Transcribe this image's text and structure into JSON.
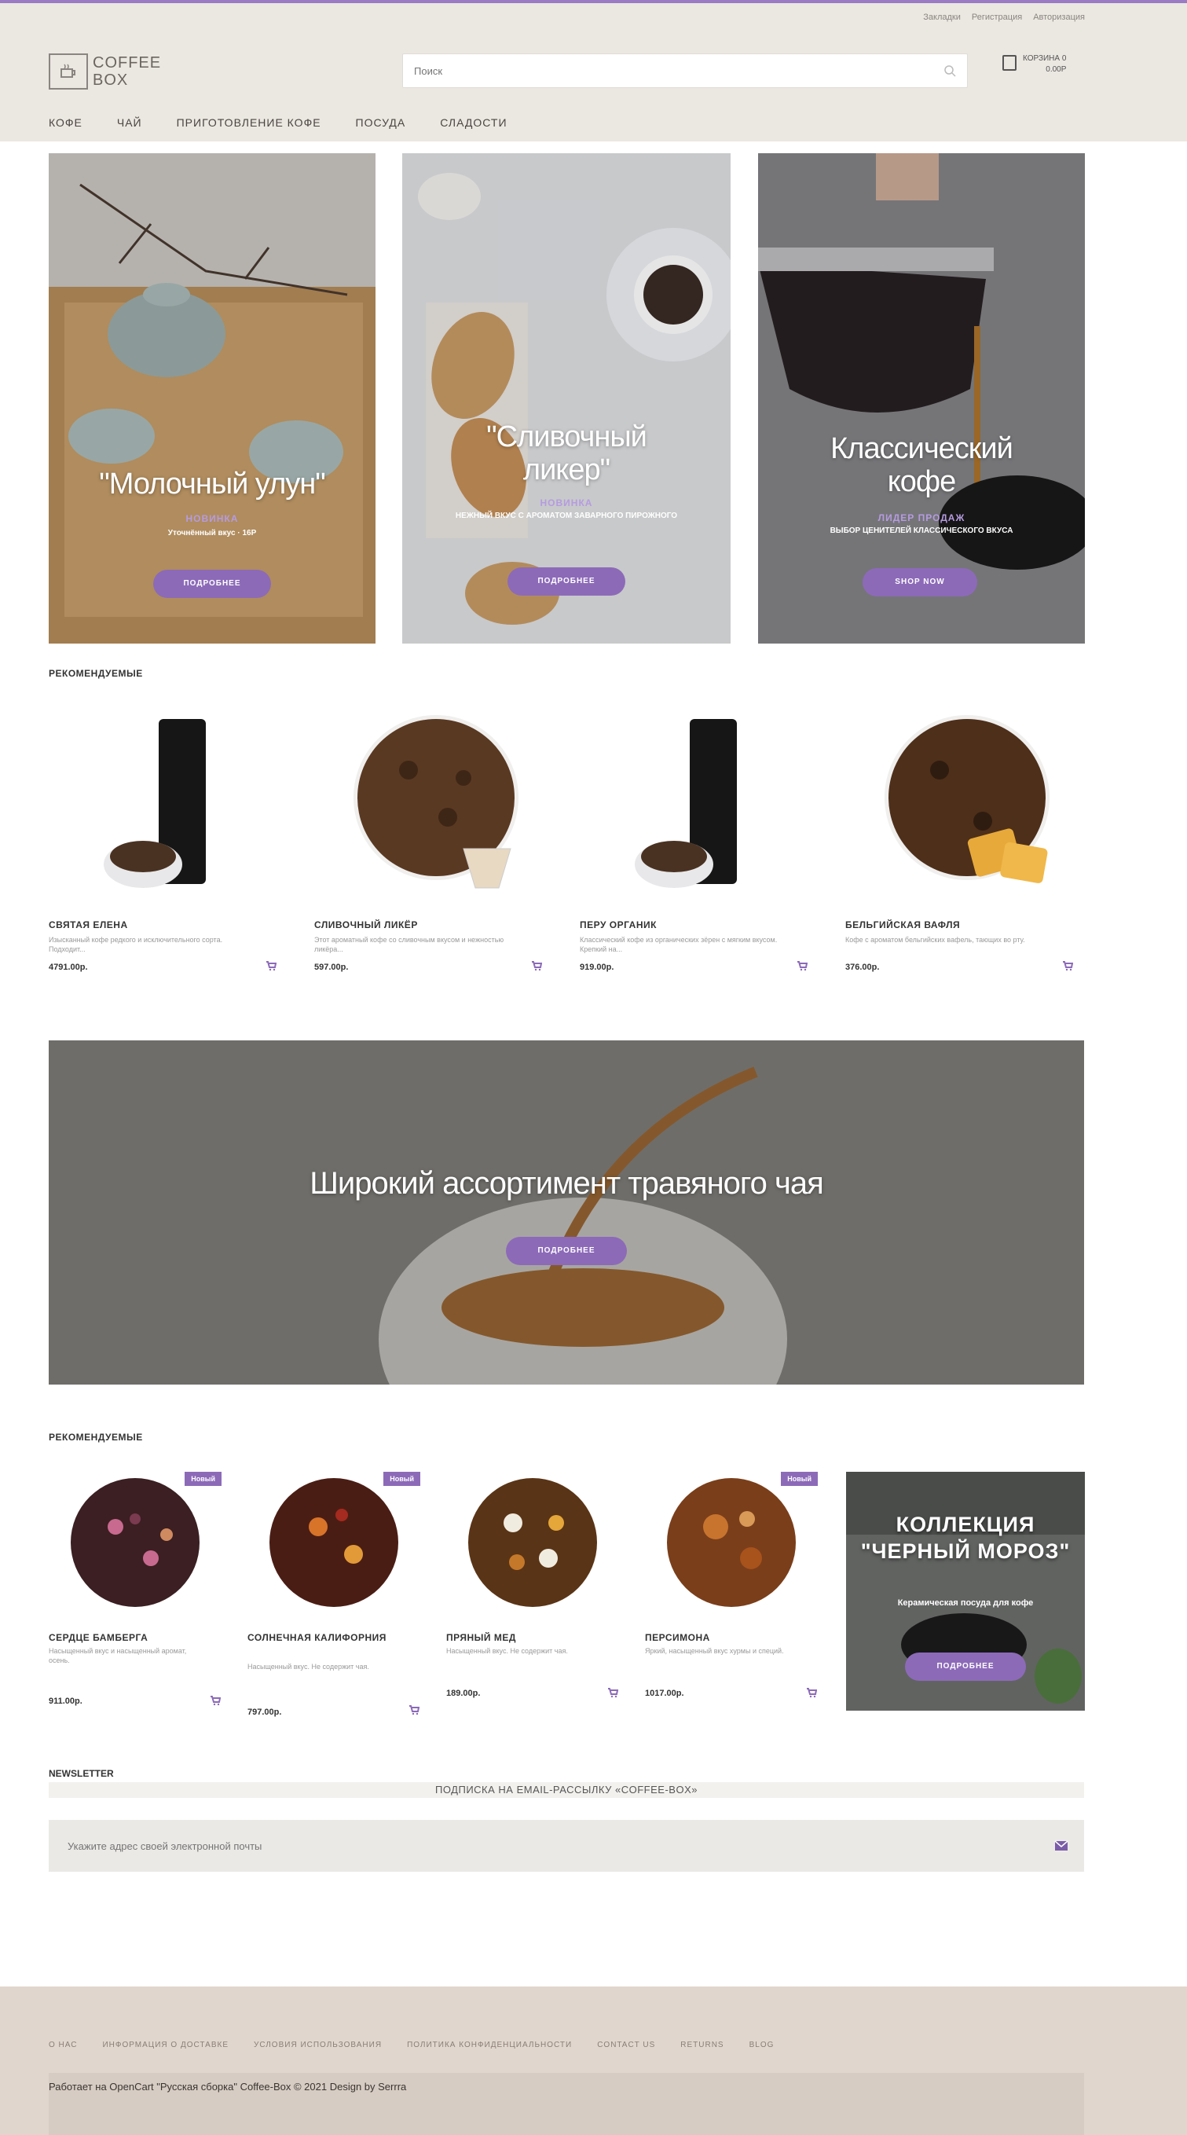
{
  "header": {
    "top_links": [
      "Закладки",
      "Регистрация",
      "Авторизация"
    ],
    "logo_line1": "COFFEE",
    "logo_line2": "BOX",
    "search_placeholder": "Поиск",
    "cart_line1": "КОРЗИНА 0",
    "cart_line2": "0.00Р"
  },
  "nav": [
    "КОФЕ",
    "ЧАЙ",
    "ПРИГОТОВЛЕНИЕ КОФЕ",
    "ПОСУДА",
    "СЛАДОСТИ"
  ],
  "banners": [
    {
      "title": "\"Молочный улун\"",
      "tag": "НОВИНКА",
      "sub": "Уточнённый вкус · 16Р",
      "button": "ПОДРОБНЕЕ"
    },
    {
      "title": "\"Сливочный ликер\"",
      "tag": "НОВИНКА",
      "sub": "НЕЖНЫЙ ВКУС С АРОМАТОМ ЗАВАРНОГО ПИРОЖНОГО",
      "button": "ПОДРОБНЕЕ"
    },
    {
      "title": "Классический кофе",
      "tag": "ЛИДЕР ПРОДАЖ",
      "sub": "ВЫБОР ЦЕНИТЕЛЕЙ КЛАССИЧЕСКОГО ВКУСА",
      "button": "SHOP NOW"
    }
  ],
  "featured_title": "РЕКОМЕНДУЕМЫЕ",
  "products": [
    {
      "name": "СВЯТАЯ ЕЛЕНА",
      "desc": "Изысканный кофе редкого и исключительного сорта. Подходит...",
      "price": "4791.00р."
    },
    {
      "name": "СЛИВОЧНЫЙ ЛИКЁР",
      "desc": "Этот ароматный кофе со сливочным вкусом и нежностью ликёра...",
      "price": "597.00р."
    },
    {
      "name": "ПЕРУ ОРГАНИК",
      "desc": "Классический кофе из органических зёрен с мягким вкусом. Крепкий на...",
      "price": "919.00р."
    },
    {
      "name": "БЕЛЬГИЙСКАЯ ВАФЛЯ",
      "desc": "Кофе с ароматом бельгийских вафель, тающих во рту.",
      "price": "376.00р."
    }
  ],
  "wide_banner": {
    "title": "Широкий ассортимент травяного чая",
    "button": "ПОДРОБНЕЕ"
  },
  "featured_title_2": "РЕКОМЕНДУЕМЫЕ",
  "teas": [
    {
      "badge": "Новый",
      "name": "СЕРДЦЕ БАМБЕРГА",
      "desc": "Насыщенный вкус и насыщенный аромат, осень.",
      "price": "911.00р."
    },
    {
      "badge": "Новый",
      "name": "СОЛНЕЧНАЯ КАЛИФОРНИЯ",
      "desc": "Насыщенный вкус. Не содержит чая.",
      "price": "797.00р."
    },
    {
      "badge": "",
      "name": "ПРЯНЫЙ МЕД",
      "desc": "Насыщенный вкус. Не содержит чая.",
      "price": "189.00р."
    },
    {
      "badge": "Новый",
      "name": "ПЕРСИМОНА",
      "desc": "Яркий, насыщенный вкус хурмы и специй.",
      "price": "1017.00р."
    }
  ],
  "collection": {
    "title": "КОЛЛЕКЦИЯ \"ЧЕРНЫЙ МОРОЗ\"",
    "sub": "Керамическая посуда для кофе",
    "button": "ПОДРОБНЕЕ"
  },
  "newsletter": {
    "title": "NEWSLETTER",
    "subtitle": "ПОДПИСКА НА EMAIL-РАССЫЛКУ «COFFEE-BOX»",
    "placeholder": "Укажите адрес своей электронной почты"
  },
  "footer": {
    "links": [
      "О НАС",
      "ИНФОРМАЦИЯ О ДОСТАВКЕ",
      "УСЛОВИЯ ИСПОЛЬЗОВАНИЯ",
      "ПОЛИТИКА КОНФИДЕНЦИАЛЬНОСТИ",
      "CONTACT US",
      "RETURNS",
      "BLOG"
    ],
    "copyright": "Работает на OpenCart \"Русская сборка\" Coffee-Box © 2021 Design by Serrra"
  },
  "colors": {
    "accent": "#8c6ab8",
    "header_bg": "#ebe7e1",
    "footer_bg": "#e0d6cd"
  }
}
